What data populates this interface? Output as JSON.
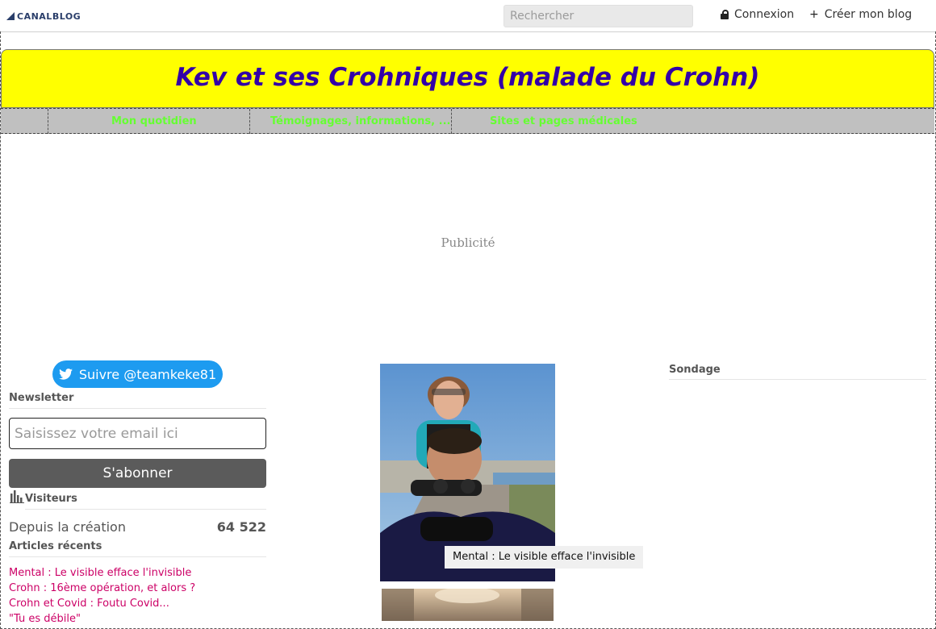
{
  "topbar": {
    "logo_text": "CANALBLOG",
    "search_placeholder": "Rechercher",
    "login_label": "Connexion",
    "create_label": "Créer mon blog"
  },
  "header": {
    "title": "Kev et ses Crohniques (malade du Crohn)"
  },
  "nav": {
    "items": [
      {
        "label": "Mon quotidien"
      },
      {
        "label": "Témoignages, informations, ..."
      },
      {
        "label": "Sites et pages médicales"
      }
    ]
  },
  "ad": {
    "label": "Publicité"
  },
  "sidebar": {
    "twitter_label": "Suivre @teamkeke81",
    "newsletter": {
      "heading": "Newsletter",
      "email_placeholder": "Saisissez votre email ici",
      "subscribe_label": "S'abonner"
    },
    "visitors": {
      "heading": "Visiteurs",
      "since_label": "Depuis la création",
      "count": "64 522"
    },
    "recent": {
      "heading": "Articles récents",
      "items": [
        "Mental : Le visible efface l'invisible",
        "Crohn : 16ème opération, et alors ?",
        "Crohn et Covid : Foutu Covid...",
        "\"Tu es débile\""
      ]
    }
  },
  "main": {
    "photo_caption": "Mental : Le visible efface l'invisible"
  },
  "right": {
    "poll_heading": "Sondage"
  },
  "colors": {
    "header_bg": "#ffff00",
    "title": "#3300a8",
    "nav_bg": "#c0c0c0",
    "nav_text": "#66ff33",
    "link": "#cc0066",
    "twitter": "#1d9bf0"
  }
}
